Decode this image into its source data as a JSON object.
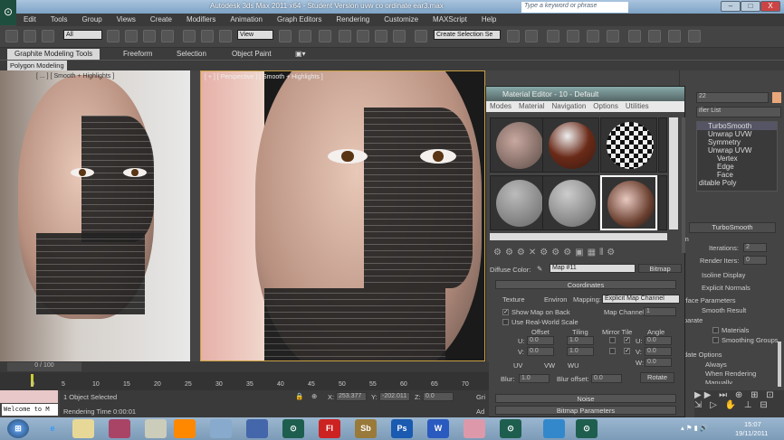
{
  "window": {
    "title": "Autodesk 3ds Max  2011 x64  - Student Version    uvw co ordinate ear3.max",
    "search_placeholder": "Type a keyword or phrase",
    "minimize": "–",
    "maximize": "□",
    "close": "X"
  },
  "menu": [
    "Edit",
    "Tools",
    "Group",
    "Views",
    "Create",
    "Modifiers",
    "Animation",
    "Graph Editors",
    "Rendering",
    "Customize",
    "MAXScript",
    "Help"
  ],
  "toolbar": {
    "filter": "All",
    "ref_coord": "View",
    "named_selection": "Create Selection Se"
  },
  "ribbon": {
    "tabs": [
      "Graphite Modeling Tools",
      "Freeform",
      "Selection",
      "Object Paint"
    ],
    "panel": "Polygon Modeling"
  },
  "viewports": {
    "left_label": "[ ... ] [ Smooth + Highlights ]",
    "persp_label": "[ + ] [ Perspective ] [ Smooth + Highlights ]"
  },
  "material_editor": {
    "title": "Material Editor - 10 - Default",
    "menu": [
      "Modes",
      "Material",
      "Navigation",
      "Options",
      "Utilities"
    ],
    "diffuse_label": "Diffuse Color:",
    "map_name": "Map #11",
    "map_type": "Bitmap",
    "coordinates": {
      "title": "Coordinates",
      "texture": "Texture",
      "environ": "Environ",
      "mapping_label": "Mapping:",
      "mapping": "Explicit Map Channel",
      "show_map": "Show Map on Back",
      "real_world": "Use Real-World Scale",
      "map_channel_label": "Map Channel:",
      "map_channel": "1",
      "offset": "Offset",
      "tiling": "Tiling",
      "mirror_tile": "Mirror Tile",
      "angle": "Angle",
      "u": "U:",
      "v": "V:",
      "w": "W:",
      "u_offset": "0.0",
      "v_offset": "0.0",
      "u_tiling": "1.0",
      "v_tiling": "1.0",
      "u_angle": "0.0",
      "v_angle": "0.0",
      "w_angle": "0.0",
      "uv": "UV",
      "vw": "VW",
      "wu": "WU",
      "blur_label": "Blur:",
      "blur": "1.0",
      "blur_offset_label": "Blur offset:",
      "blur_offset": "0.0",
      "rotate": "Rotate"
    },
    "noise": "Noise",
    "bitmap_params": "Bitmap Parameters"
  },
  "command_panel": {
    "object_name": "22",
    "modifier_list": "ifier List",
    "stack": [
      "TurboSmooth",
      "Unwrap UVW",
      "Symmetry",
      "Unwrap UVW",
      "Vertex",
      "Edge",
      "Face",
      "ditable Poly"
    ],
    "rollout": "TurboSmooth",
    "main": "in",
    "iterations_label": "Iterations:",
    "iterations": "2",
    "render_iters_label": "Render Iters:",
    "render_iters": "0",
    "isoline": "Isoline Display",
    "explicit_normals": "Explicit Normals",
    "surface_params": "rface Parameters",
    "smooth_result": "Smooth Result",
    "separate": "parate",
    "materials": "Materials",
    "smoothing_groups": "Smoothing Groups",
    "update_options": "date Options",
    "always": "Always",
    "when_rendering": "When Rendering",
    "manually": "Manually"
  },
  "timeline": {
    "frame": "0 / 100",
    "ticks": [
      "0",
      "5",
      "10",
      "15",
      "20",
      "25",
      "30",
      "35",
      "40",
      "45",
      "50",
      "55",
      "60",
      "65",
      "70"
    ]
  },
  "status": {
    "welcome": "Welcome to M",
    "selected": "1 Object Selected",
    "render_time": "Rendering Time  0:00:01",
    "x_label": "X:",
    "x": "253.377",
    "y_label": "Y:",
    "y": "-202.011",
    "z_label": "Z:",
    "z": "0.0",
    "grid": "Gri",
    "add": "Ad"
  },
  "taskbar": {
    "time": "15:07",
    "date": "19/11/2011",
    "apps": [
      "Fl",
      "Sb",
      "Ps",
      "W"
    ]
  }
}
